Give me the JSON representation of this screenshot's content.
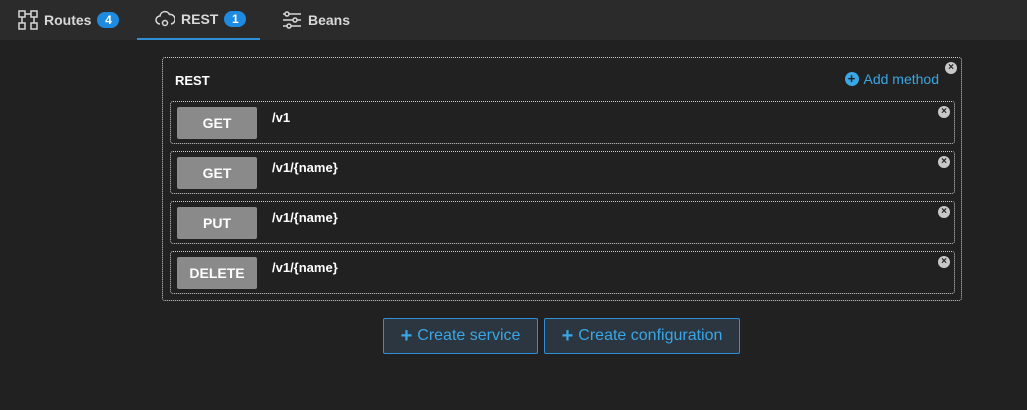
{
  "tabs": [
    {
      "label": "Routes",
      "badge": "4",
      "icon": "routes-icon"
    },
    {
      "label": "REST",
      "badge": "1",
      "icon": "rest-cloud-icon",
      "active": true
    },
    {
      "label": "Beans",
      "icon": "sliders-icon"
    }
  ],
  "panel": {
    "title": "REST",
    "add_method_label": "Add method",
    "methods": [
      {
        "verb": "GET",
        "path": "/v1"
      },
      {
        "verb": "GET",
        "path": "/v1/{name}"
      },
      {
        "verb": "PUT",
        "path": "/v1/{name}"
      },
      {
        "verb": "DELETE",
        "path": "/v1/{name}"
      }
    ]
  },
  "actions": {
    "create_service_label": "Create service",
    "create_configuration_label": "Create configuration"
  },
  "colors": {
    "accent": "#39a6e6",
    "badge": "#1f8be0",
    "background": "#212121",
    "method_button": "#8a8a8a"
  }
}
